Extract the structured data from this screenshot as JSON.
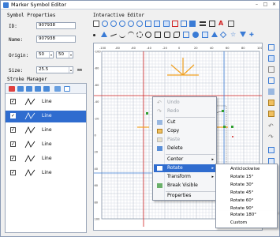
{
  "window": {
    "title": "Marker Symbol Editor",
    "minimize": "–",
    "maximize": "□",
    "close": "✕"
  },
  "symbol_properties": {
    "heading": "Symbol Properties",
    "id_label": "ID:",
    "id_value": "907938",
    "name_label": "Name:",
    "name_value": "907938",
    "origin_label": "Origin:",
    "origin_x": "50",
    "origin_y": "50",
    "size_label": "Size:",
    "size_value": "25.5",
    "size_unit": "mm",
    "origin_spin_arrow": "▾",
    "size_spin_arrow": "▴"
  },
  "stroke_manager": {
    "heading": "Stroke Manager",
    "rows": [
      {
        "label": "Line",
        "checked": "✓",
        "selected": false
      },
      {
        "label": "Line",
        "checked": "✓",
        "selected": true
      },
      {
        "label": "Line",
        "checked": "✓",
        "selected": false
      },
      {
        "label": "Line",
        "checked": "✓",
        "selected": false
      },
      {
        "label": "Line",
        "checked": "✓",
        "selected": false
      },
      {
        "label": "Line",
        "checked": "✓",
        "selected": false
      }
    ]
  },
  "editor": {
    "heading": "Interactive Editor",
    "ruler_top": [
      "-100",
      "-80",
      "-60",
      "-40",
      "-20",
      "0",
      "20",
      "40",
      "60",
      "80",
      "100"
    ],
    "ruler_left": [
      "-100",
      "-80",
      "-60",
      "-40",
      "-20",
      "0",
      "20",
      "40",
      "60",
      "80",
      "100"
    ]
  },
  "context_menu": {
    "undo": "Undo",
    "redo": "Redo",
    "cut": "Cut",
    "copy": "Copy",
    "paste": "Paste",
    "delete": "Delete",
    "center": "Center",
    "rotate": "Rotate",
    "transform": "Transform",
    "break_visible": "Break Visible",
    "properties": "Properties",
    "submenu_arrow": "▸"
  },
  "rotate_submenu": {
    "items": [
      "Anticlockwise",
      "Rotate 15°",
      "Rotate 30°",
      "Rotate 45°",
      "Rotate 60°",
      "Rotate 90°",
      "Rotate 180°",
      "Custom"
    ]
  },
  "colors": {
    "accent": "#2f6ccf",
    "axis_red": "#d02020",
    "shape_orange": "#f0a020",
    "handle_green": "#30a030",
    "grid": "#d8dde6"
  }
}
